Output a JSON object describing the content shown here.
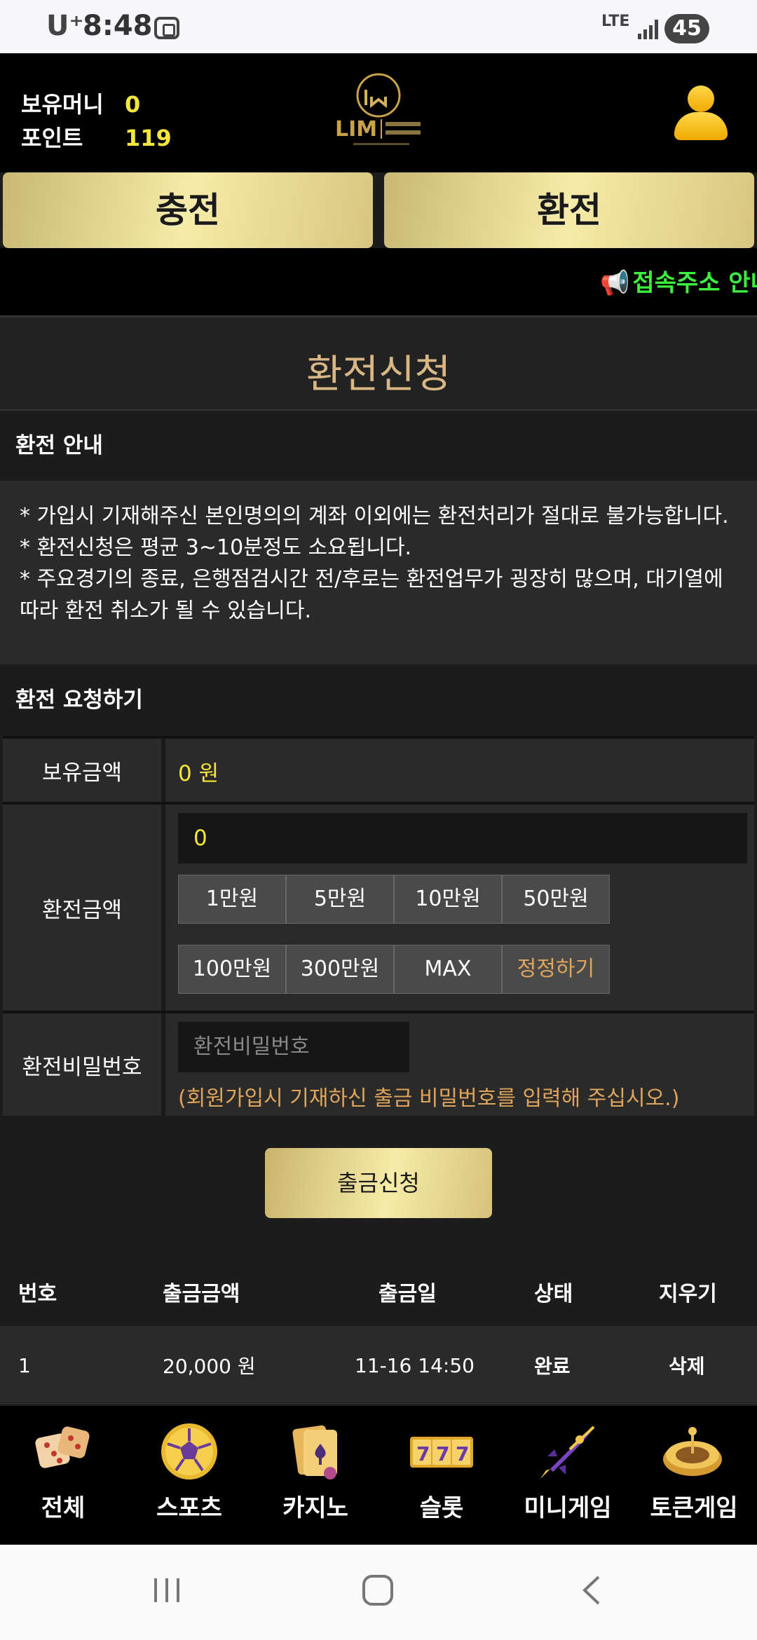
{
  "status_bar": {
    "carrier": "U⁺",
    "time": "8:48",
    "network": "LTE",
    "battery": "45"
  },
  "header": {
    "money_label": "보유머니",
    "money_value": "0",
    "point_label": "포인트",
    "point_value": "119",
    "logo_text": "LIM"
  },
  "actions": {
    "deposit": "충전",
    "withdraw": "환전"
  },
  "notice": {
    "text": "접속주소 안내"
  },
  "page_title": "환전신청",
  "guide": {
    "title": "환전 안내",
    "lines": [
      "* 가입시 기재해주신 본인명의의 계좌 이외에는 환전처리가 절대로 불가능합니다.",
      "* 환전신청은 평균 3~10분정도 소요됩니다.",
      "* 주요경기의 종료, 은행점검시간 전/후로는 환전업무가 굉장히 많으며, 대기열에",
      "따라 환전 취소가 될 수 있습니다."
    ]
  },
  "request": {
    "title": "환전 요청하기",
    "balance_label": "보유금액",
    "balance_value": "0 원",
    "amount_label": "환전금액",
    "amount_value": "0",
    "quick": [
      "1만원",
      "5만원",
      "10만원",
      "50만원",
      "100만원",
      "300만원",
      "MAX",
      "정정하기"
    ],
    "password_label": "환전비밀번호",
    "password_placeholder": "환전비밀번호",
    "password_hint": "(회원가입시 기재하신 출금 비밀번호를 입력해 주십시오.)",
    "submit": "출금신청"
  },
  "history": {
    "headers": [
      "번호",
      "출금금액",
      "출금일",
      "상태",
      "지우기"
    ],
    "rows": [
      {
        "no": "1",
        "amount": "20,000 원",
        "date": "11-16 14:50",
        "status": "완료",
        "action": "삭제"
      }
    ]
  },
  "game_nav": [
    {
      "label": "전체",
      "icon": "dice-icon"
    },
    {
      "label": "스포츠",
      "icon": "soccer-ball-icon"
    },
    {
      "label": "카지노",
      "icon": "cards-icon"
    },
    {
      "label": "슬롯",
      "icon": "slot-777-icon"
    },
    {
      "label": "미니게임",
      "icon": "rocket-icon"
    },
    {
      "label": "토큰게임",
      "icon": "roulette-icon"
    }
  ],
  "colors": {
    "gold": "#d8b784",
    "yellow": "#f5e63c",
    "green": "#3df03d",
    "orange": "#e0a55a"
  }
}
